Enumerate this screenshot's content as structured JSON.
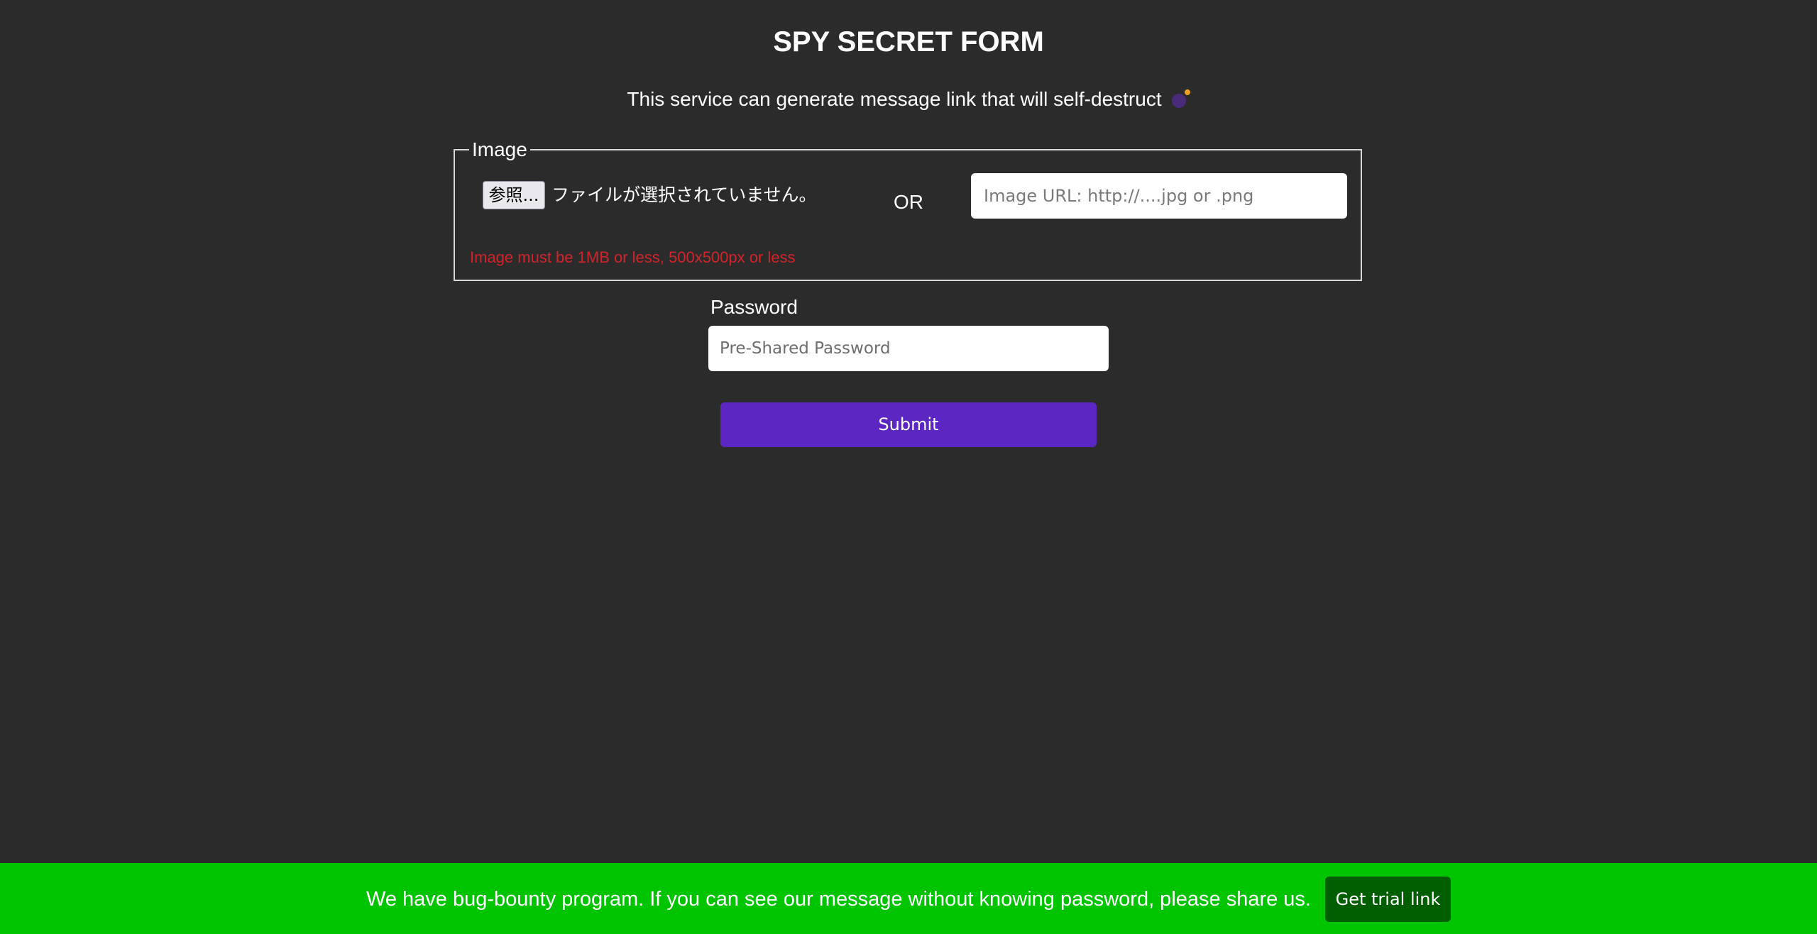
{
  "header": {
    "title": "SPY SECRET FORM",
    "subtitle": "This service can generate message link that will self-destruct",
    "subtitle_icon": "bomb-icon"
  },
  "image_section": {
    "legend": "Image",
    "browse_label": "参照...",
    "no_file_text": "ファイルが選択されていません。",
    "or_text": "OR",
    "url_placeholder": "Image URL: http://....jpg or .png",
    "url_value": "",
    "hint": "Image must be 1MB or less, 500x500px or less"
  },
  "password_section": {
    "label": "Password",
    "placeholder": "Pre-Shared Password",
    "value": ""
  },
  "submit": {
    "label": "Submit"
  },
  "banner": {
    "text": "We have bug-bounty program. If you can see our message without knowing password, please share us.",
    "button_label": "Get trial link"
  },
  "colors": {
    "background": "#2b2b2b",
    "submit": "#5b26c2",
    "banner": "#00c400",
    "banner_button": "#005d00",
    "hint": "#d0242b"
  }
}
